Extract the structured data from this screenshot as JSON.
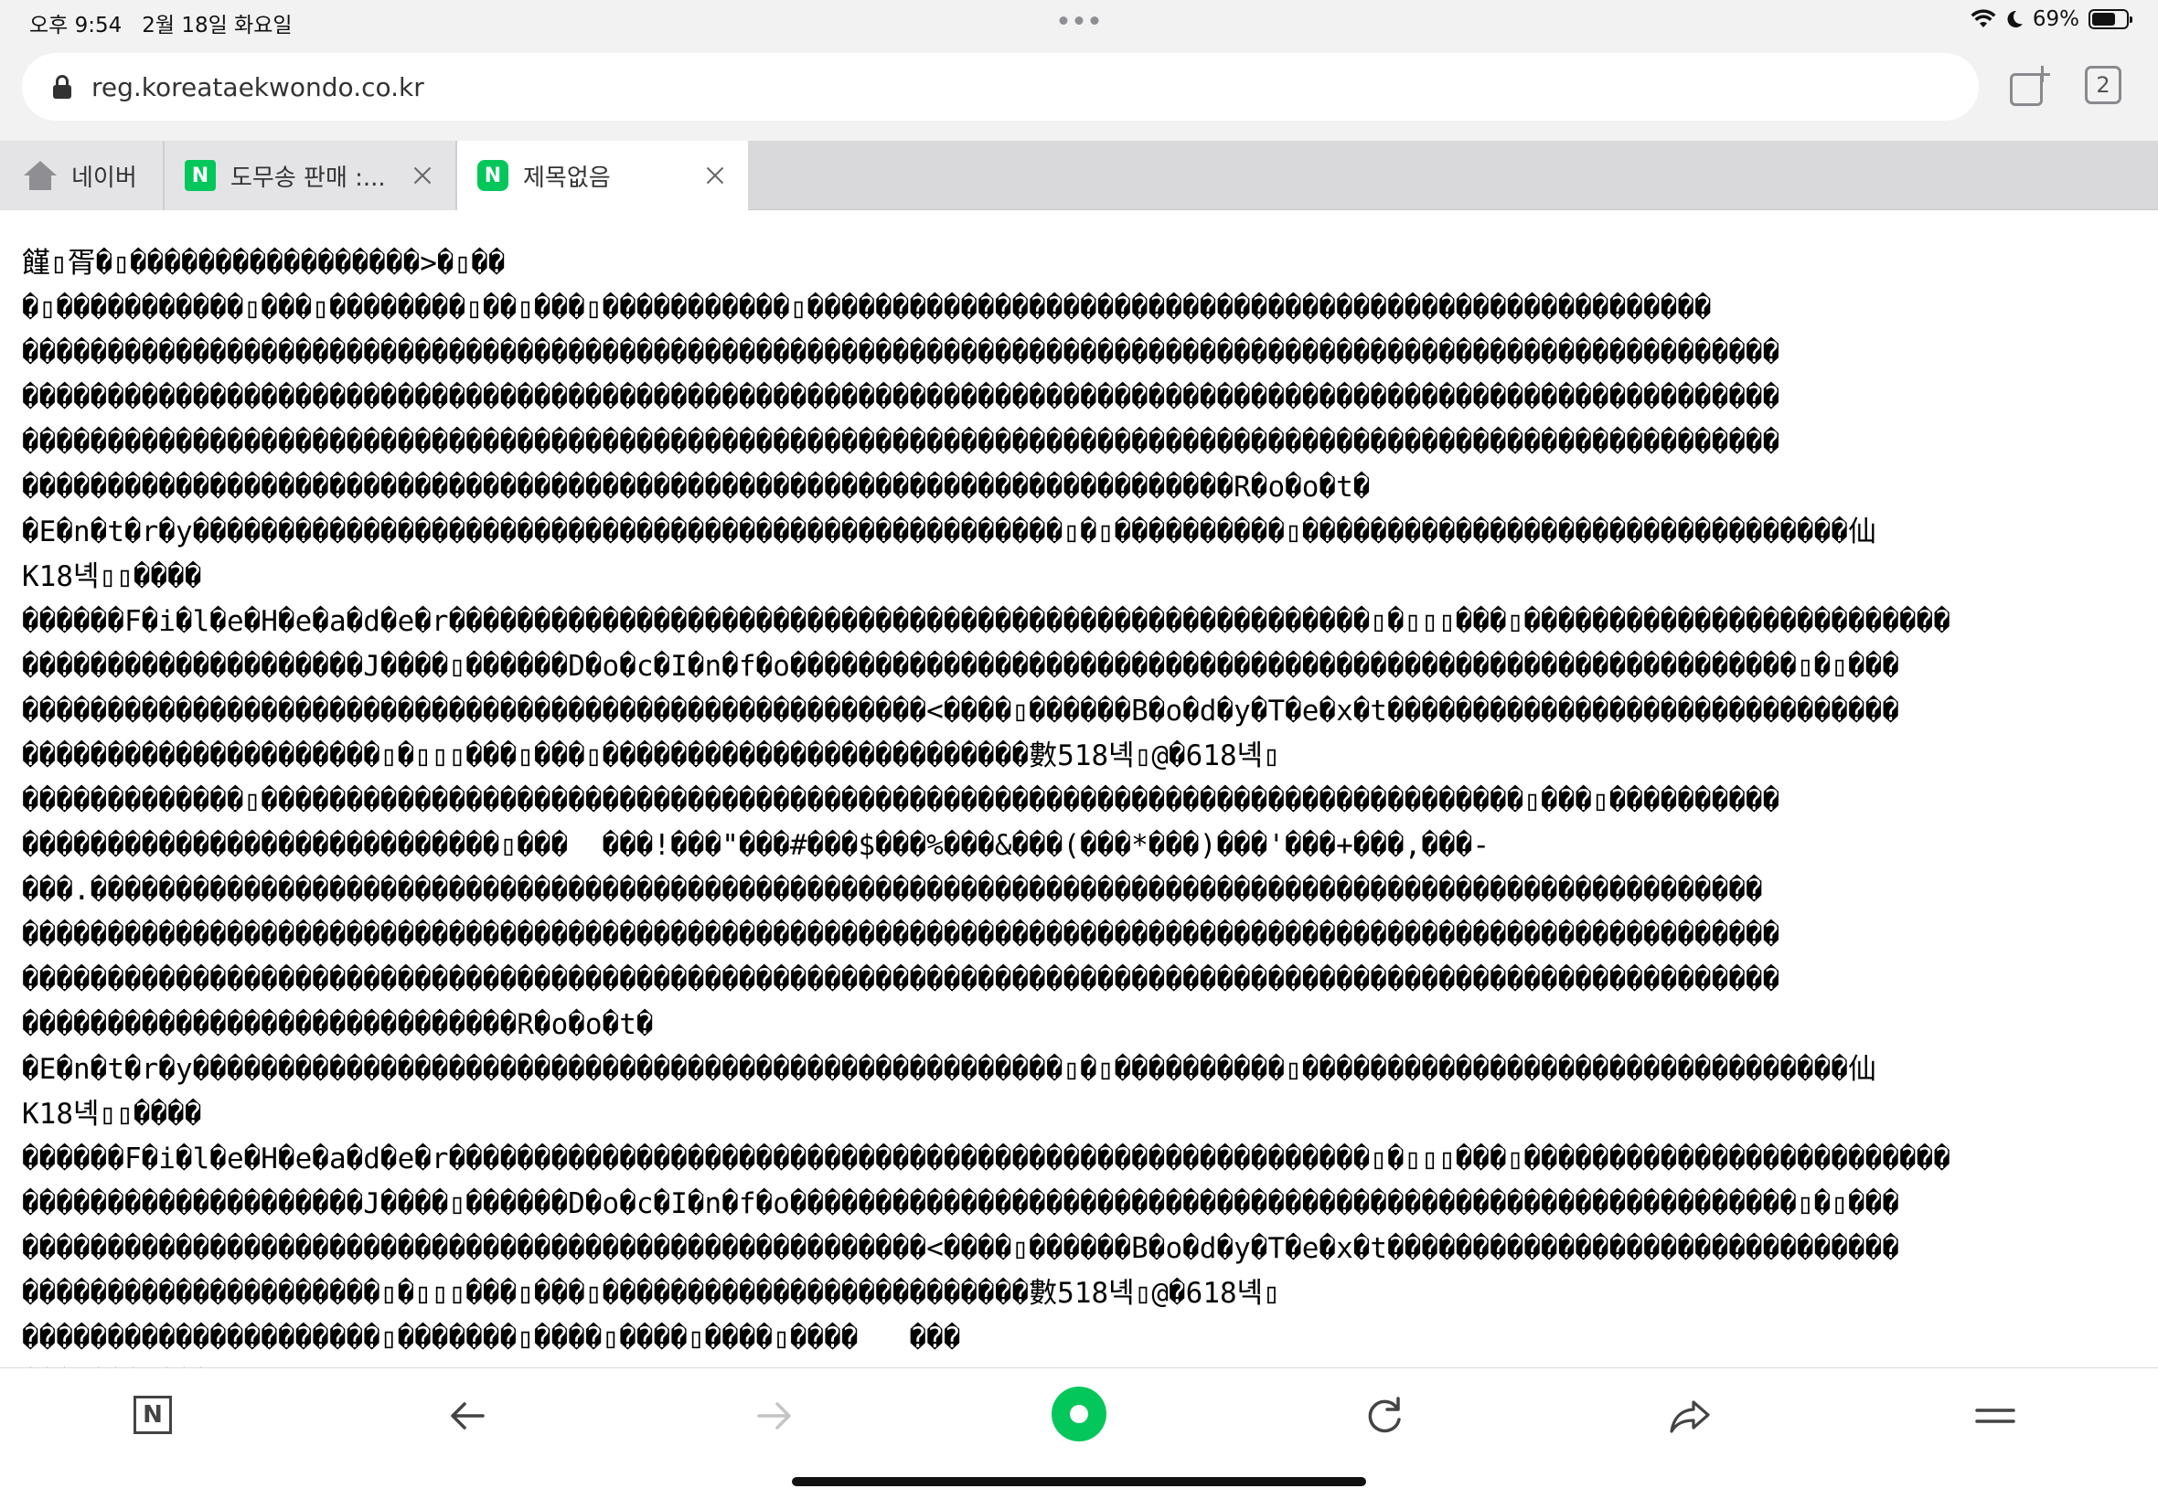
{
  "status_bar": {
    "time_date": "오후 9:54   2월 18일 화요일",
    "battery_percent": "69%",
    "battery_level": 0.69,
    "icons": [
      "wifi-icon",
      "moon-icon",
      "battery-icon"
    ]
  },
  "address_bar": {
    "url": "reg.koreataekwondo.co.kr",
    "tab_count": "2"
  },
  "tabs": [
    {
      "label": "네이버",
      "icon": "home-icon"
    },
    {
      "label": "도무송 판매 :...",
      "icon": "naver-n-icon",
      "logo": "N"
    },
    {
      "label": "제목없음",
      "icon": "naver-n-icon",
      "logo": "N",
      "active": true
    }
  ],
  "content": {
    "lines": [
      "饉▯胥�▯�����������������>�▯��",
      "�▯�����������▯���▯��������▯��▯���▯�����������▯�����������������������������������������������������",
      "�������������������������������������������������������������������������������������������������������",
      "�������������������������������������������������������������������������������������������������������",
      "�������������������������������������������������������������������������������������������������������",
      "�����������������������������������������������������������������������R�o�o�t�",
      "�E�n�t�r�y���������������������������������������������������▯�▯����������▯��������������������������������仙",
      "K18녝▯▯����",
      "������F�i�l�e�H�e�a�d�e�r������������������������������������������������������▯�▯▯▯���▯�������������������������",
      "��������������������J����▯������D�o�c�I�n�f�o�����������������������������������������������������������▯�▯���",
      "�����������������������������������������������������<����▯������B�o�d�y�T�e�x�t������������������������������",
      "���������������������▯�▯▯▯���▯���▯�������������������������數518녝▯@�618녝▯",
      "�������������▯��������������������������������������������������������������������������▯���▯����������",
      "����������������������������▯���  ���!���\"���#���$���%���&���(���*���)���'���+���,���-",
      "���.��������������������������������������������������������������������������������������������������",
      "�������������������������������������������������������������������������������������������������������",
      "�������������������������������������������������������������������������������������������������������",
      "�����������������������������R�o�o�t�",
      "�E�n�t�r�y���������������������������������������������������▯�▯����������▯��������������������������������仙",
      "K18녝▯▯����",
      "������F�i�l�e�H�e�a�d�e�r������������������������������������������������������▯�▯▯▯���▯�������������������������",
      "��������������������J����▯������D�o�c�I�n�f�o�����������������������������������������������������������▯�▯���",
      "�����������������������������������������������������<����▯������B�o�d�y�T�e�x�t������������������������������",
      "���������������������▯�▯▯▯���▯���▯�������������������������數518녝▯@�618녝▯",
      "���������������������▯�������▯����▯����▯����▯����   ���",
      "��� ��� ���"
    ]
  },
  "toolbar": {
    "naver_label": "N",
    "buttons": [
      "naver-home-button",
      "back-button",
      "forward-button",
      "green-dot-button",
      "reload-button",
      "share-button",
      "menu-button"
    ]
  }
}
